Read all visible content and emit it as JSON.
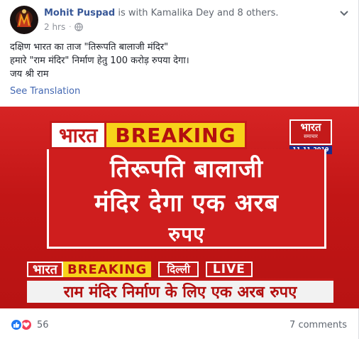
{
  "header": {
    "author": "Mohit Puspad",
    "tag_text": "is with Kamalika Dey and 8 others.",
    "time": "2 hrs",
    "separator": "·",
    "icons": [
      "avatar",
      "globe-icon",
      "chevron-down-icon"
    ]
  },
  "post": {
    "lines": [
      "दक्षिण भारत का ताज \"तिरूपति बालाजी मंदिर\"",
      "हमारे \"राम मंदिर\" निर्माण हेतु 100 करोड़ रुपया देगा।",
      "जय श्री राम"
    ],
    "see_translation": "See Translation"
  },
  "news_image": {
    "channel": "भारत",
    "breaking": "BREAKING",
    "logo_top": "भारत",
    "logo_bottom": "समाचार",
    "date": "11-11-2019",
    "headline_lines": [
      "तिरूपति बालाजी",
      "मंदिर देगा एक अरब",
      "रुपए"
    ],
    "ticker_channel": "भारत",
    "ticker_breaking": "BREAKING",
    "city": "दिल्ली",
    "live": "LIVE",
    "ticker_text": "राम मंदिर निर्माण के लिए एक अरब रुपए"
  },
  "footer": {
    "reaction_count": "56",
    "comments": "7 comments"
  },
  "colors": {
    "link": "#385898",
    "news_red": "#c41a1a",
    "breaking_yellow": "#f7d21a",
    "like_blue": "#2078f4",
    "love_red": "#f33e58"
  }
}
